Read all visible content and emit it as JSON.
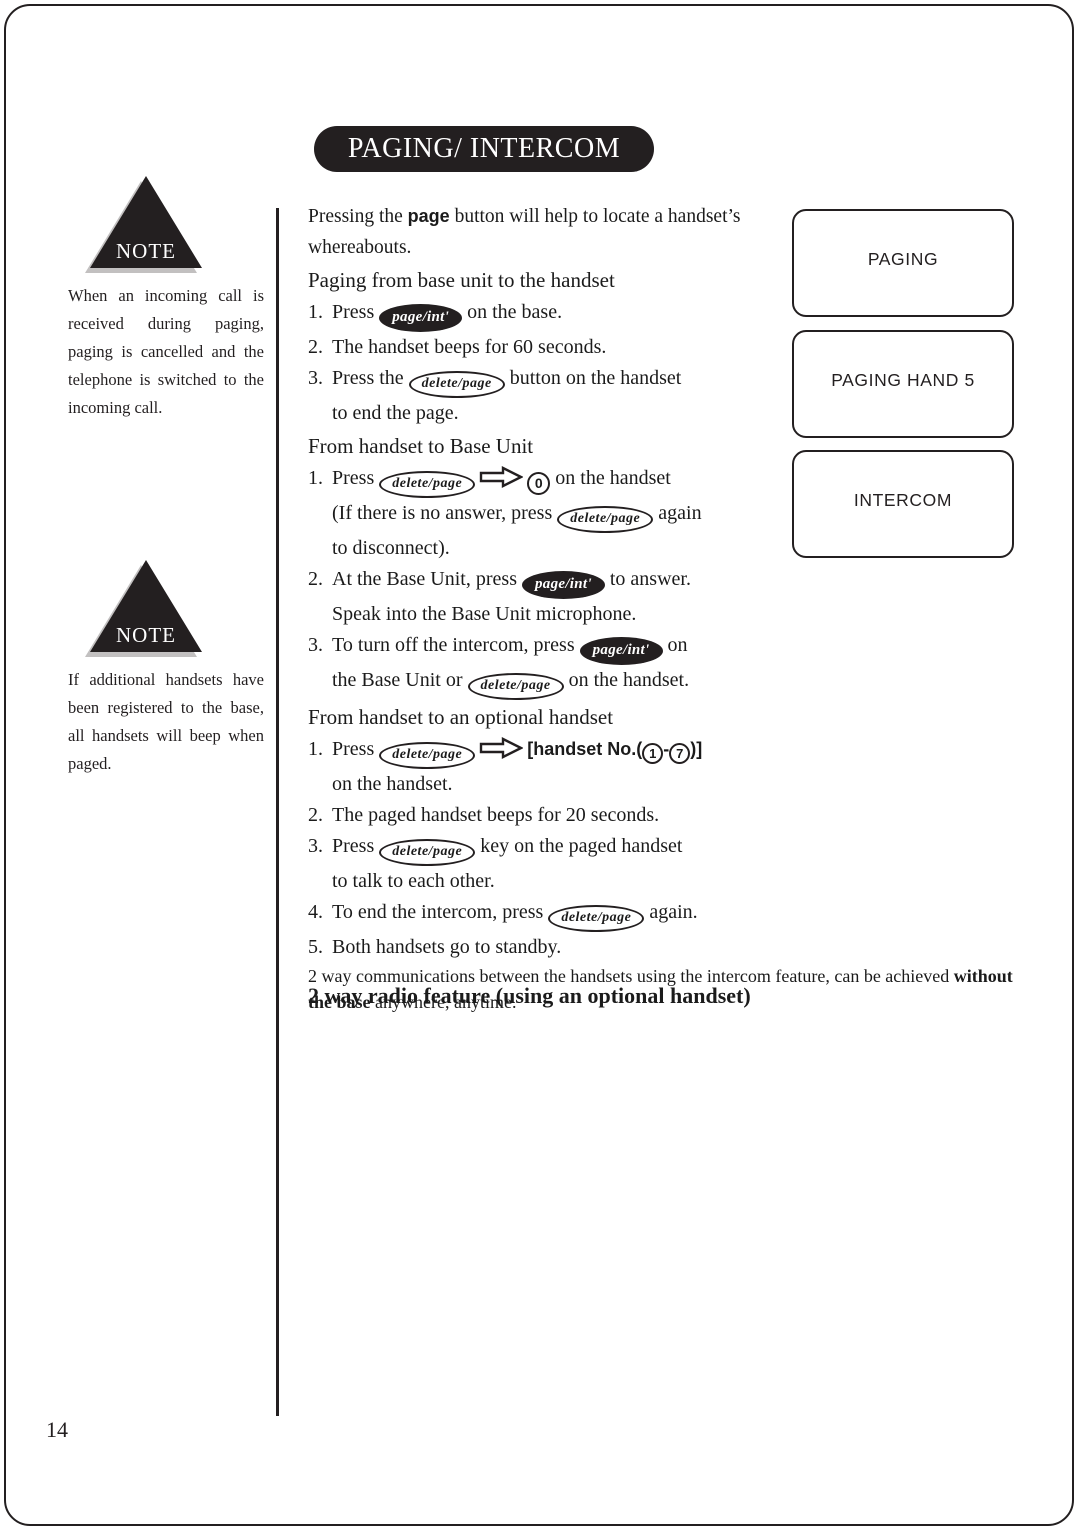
{
  "page": {
    "title": "PAGING/ INTERCOM",
    "number": "14",
    "colors": {
      "ink": "#231f20",
      "banner_bg": "#231f20",
      "banner_text": "#ffffff"
    }
  },
  "notes": [
    {
      "label": "NOTE",
      "text": "When an incoming call is received during paging, paging is cancelled and the telephone is switched to the incoming call."
    },
    {
      "label": "NOTE",
      "text": "If additional handsets have been registered to the base, all handsets will beep when paged."
    }
  ],
  "keys": {
    "page_int": "page/int'",
    "delete_page": "delete/page",
    "zero": "0",
    "one": "1",
    "seven": "7"
  },
  "body": {
    "intro_1": "Pressing the ",
    "intro_bold": "page",
    "intro_2": " button will help to locate a handset’s",
    "intro_3": "whereabouts.",
    "sections": [
      {
        "heading": "Paging from base unit to the handset",
        "steps": [
          {
            "num": "1.",
            "pre": "Press ",
            "post": " on the base."
          },
          {
            "num": "2.",
            "pre": "The handset beeps for 60 seconds.",
            "post": ""
          },
          {
            "num": "3.",
            "pre": "Press the ",
            "post": " button on the handset",
            "cont": "to end the page."
          }
        ]
      },
      {
        "heading": "From handset to Base Unit",
        "steps": [
          {
            "num": "1.",
            "pre": "Press ",
            "post": " on the handset",
            "line2_pre": "(If there is no answer, press ",
            "line2_post": " again",
            "line3": "to disconnect)."
          },
          {
            "num": "2.",
            "pre": "At the Base Unit, press ",
            "post": " to answer.",
            "cont": "Speak into the Base Unit microphone."
          },
          {
            "num": "3.",
            "pre": "To turn off the intercom, press ",
            "post": " on",
            "cont_pre": "the Base Unit or ",
            "cont_post": " on the handset."
          }
        ]
      },
      {
        "heading": "From handset to an optional handset",
        "steps": [
          {
            "num": "1.",
            "pre": "Press ",
            "handset_open": "[handset No.(",
            "handset_dash": "-",
            "handset_close": ")]",
            "cont": "on the handset."
          },
          {
            "num": "2.",
            "pre": "The paged handset beeps for 20 seconds.",
            "post": ""
          },
          {
            "num": "3.",
            "pre": "Press ",
            "post": " key on the paged handset",
            "cont": "to talk to each other."
          },
          {
            "num": "4.",
            "pre": "To end the intercom, press ",
            "post": " again."
          },
          {
            "num": "5.",
            "pre": " Both handsets go to standby.",
            "post": ""
          }
        ]
      }
    ],
    "radio": {
      "heading": "2 way radio feature (using an optional handset)",
      "line1": "2 way communications between the handsets using the intercom feature, can be achieved",
      "bold": "without the base",
      "line2_tail": " anywhere, anytime."
    }
  },
  "lcd_boxes": [
    {
      "text": "PAGING"
    },
    {
      "text": "PAGING HAND 5"
    },
    {
      "text": "INTERCOM"
    }
  ]
}
